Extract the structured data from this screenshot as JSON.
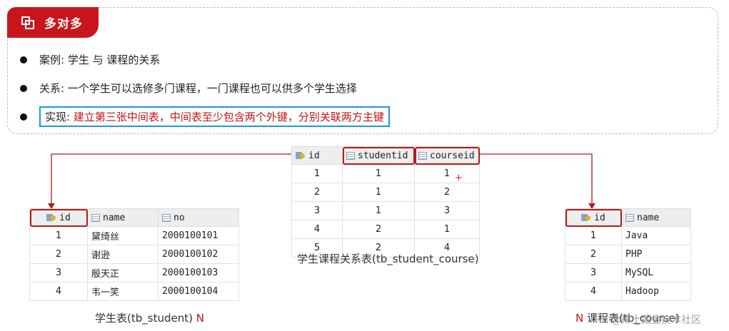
{
  "section_title": "多对多",
  "bullets": [
    {
      "label": "案例: 学生 与 课程的关系"
    },
    {
      "label": "关系: 一个学生可以选修多门课程，一门课程也可以供多个学生选择"
    },
    {
      "prefix": "实现: ",
      "body": "建立第三张中间表，中间表至少包含两个外键，分别关联两方主键"
    }
  ],
  "student_table": {
    "caption": "学生表(tb_student)",
    "multiplicity": "N",
    "columns": [
      "id",
      "name",
      "no"
    ],
    "rows": [
      [
        "1",
        "黛绮丝",
        "2000100101"
      ],
      [
        "2",
        "谢逊",
        "2000100102"
      ],
      [
        "3",
        "殷天正",
        "2000100103"
      ],
      [
        "4",
        "韦一笑",
        "2000100104"
      ]
    ]
  },
  "link_table": {
    "caption": "学生课程关系表(tb_student_course)",
    "columns": [
      "id",
      "studentid",
      "courseid"
    ],
    "rows": [
      [
        "1",
        "1",
        "1"
      ],
      [
        "2",
        "1",
        "2"
      ],
      [
        "3",
        "1",
        "3"
      ],
      [
        "4",
        "2",
        "1"
      ],
      [
        "5",
        "2",
        "4"
      ]
    ],
    "marker": "+"
  },
  "course_table": {
    "caption": "课程表(tb_course)",
    "multiplicity": "N",
    "columns": [
      "id",
      "name"
    ],
    "rows": [
      [
        "1",
        "Java"
      ],
      [
        "2",
        "PHP"
      ],
      [
        "3",
        "MySQL"
      ],
      [
        "4",
        "Hadoop"
      ]
    ]
  },
  "watermark": "@稀土掘金技术社区",
  "colors": {
    "accent_red": "#c8161d",
    "highlight_blue": "#1a9ad6",
    "relation_line": "#b51a1a"
  }
}
